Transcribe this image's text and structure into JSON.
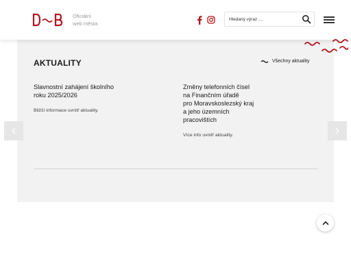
{
  "header": {
    "logo_label": "D~B",
    "logo_subtitle_line1": "Oficiální",
    "logo_subtitle_line2": "web města",
    "social": [
      {
        "icon": "facebook-icon"
      },
      {
        "icon": "instagram-icon"
      }
    ],
    "search_placeholder": "Hledaný výraz ....",
    "search_icon": "search-icon",
    "menu_icon": "hamburger-menu-icon"
  },
  "colors": {
    "brand_red": "#b3151e",
    "panel_bg": "#f2f2f2",
    "text": "#1a1a1a"
  },
  "news": {
    "section_title": "AKTUALITY",
    "all_news_label": "Všechny aktuality",
    "items": [
      {
        "title_lines": [
          "Slavnostní zahájení školního",
          "roku 2025/2026"
        ],
        "description": "Bližší informace uvnitř aktuality."
      },
      {
        "title_lines": [
          "Změny telefonních čísel",
          "na Finančním úřadě",
          "pro Moravskoslezský kraj",
          "a jeho územních",
          "pracovištích"
        ],
        "description": "Více info uvnitř aktuality."
      }
    ]
  },
  "carousel": {
    "prev_icon": "chevron-left-icon",
    "next_icon": "chevron-right-icon"
  },
  "scroll_top_icon": "chevron-up-icon"
}
